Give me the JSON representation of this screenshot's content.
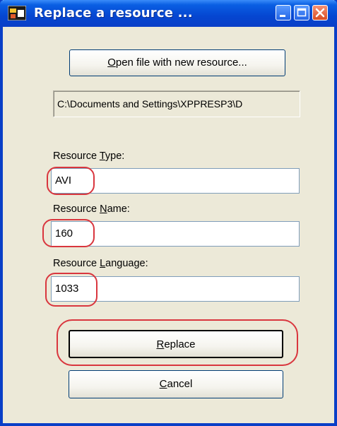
{
  "window": {
    "title": "Replace a resource ..."
  },
  "buttons": {
    "open_prefix": "",
    "open_mnemonic": "O",
    "open_rest": "pen file with new resource...",
    "replace_mnemonic": "R",
    "replace_rest": "eplace",
    "cancel_mnemonic": "C",
    "cancel_rest": "ancel"
  },
  "path": {
    "value": "C:\\Documents and Settings\\XPPRESP3\\D"
  },
  "fields": {
    "type": {
      "label_prefix": "Resource ",
      "label_mnemonic": "T",
      "label_rest": "ype:",
      "value": "AVI"
    },
    "name": {
      "label_prefix": "Resource ",
      "label_mnemonic": "N",
      "label_rest": "ame:",
      "value": "160"
    },
    "language": {
      "label_prefix": "Resource ",
      "label_mnemonic": "L",
      "label_rest": "anguage:",
      "value": "1033"
    }
  },
  "colors": {
    "titlebar": "#0a5fe3",
    "dialog_face": "#ece9d8",
    "highlight_annotation": "#d9363e"
  },
  "icons": {
    "app": "resource-editor-icon",
    "minimize": "minimize-icon",
    "maximize": "maximize-icon",
    "close": "close-icon"
  }
}
